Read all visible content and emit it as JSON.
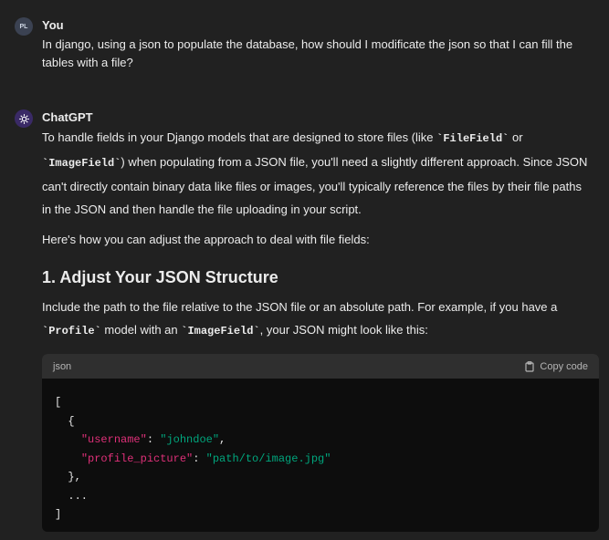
{
  "user_message": {
    "avatar_initials": "PL",
    "author": "You",
    "text": "In django, using a json to populate the database, how should I modificate the json so that I can fill the tables with a file?"
  },
  "assistant_message": {
    "author": "ChatGPT",
    "p1": {
      "a": "To handle fields in your Django models that are designed to store files (like ",
      "code1": "`FileField`",
      "b": " or ",
      "code2": "`ImageField`",
      "c": ") when populating from a JSON file, you'll need a slightly different approach. Since JSON can't directly contain binary data like files or images, you'll typically reference the files by their file paths in the JSON and then handle the file uploading in your script."
    },
    "p2": "Here's how you can adjust the approach to deal with file fields:",
    "heading1": "1. Adjust Your JSON Structure",
    "p3": {
      "a": "Include the path to the file relative to the JSON file or an absolute path. For example, if you have a ",
      "code1": "`Profile`",
      "b": " model with an ",
      "code2": "`ImageField`",
      "c": ", your JSON might look like this:"
    },
    "code_block": {
      "language": "json",
      "copy_label": "Copy code",
      "lines": {
        "l1": "[",
        "l2": "  {",
        "l3_indent": "    ",
        "l3_key": "\"username\"",
        "l3_sep": ": ",
        "l3_val": "\"johndoe\"",
        "l3_end": ",",
        "l4_indent": "    ",
        "l4_key": "\"profile_picture\"",
        "l4_sep": ": ",
        "l4_val": "\"path/to/image.jpg\"",
        "l5": "  },",
        "l6": "  ...",
        "l7": "]"
      }
    }
  },
  "colors": {
    "background": "#212121",
    "code_background": "#0d0d0d",
    "code_header": "#2f2f2f",
    "json_key": "#df3079",
    "json_string": "#00a67d"
  }
}
